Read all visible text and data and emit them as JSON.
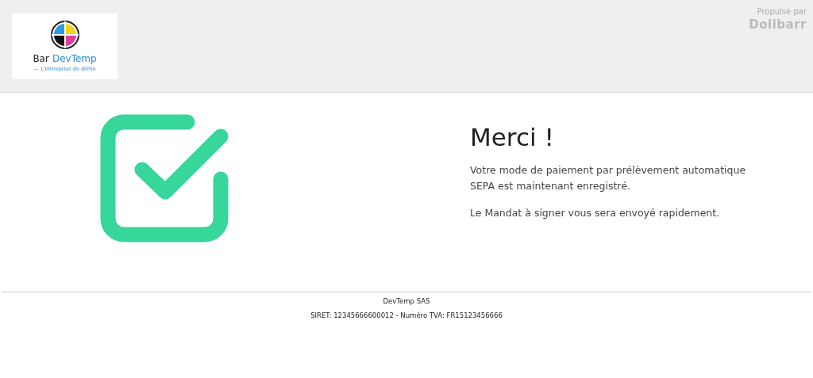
{
  "header": {
    "logo": {
      "name_part1": "Bar",
      "name_part2": "DevTemp",
      "tagline": "— L'entreprise de démo"
    },
    "powered_by": {
      "label": "Propulsé par",
      "brand": "Dolibarr"
    }
  },
  "message": {
    "title": "Merci !",
    "paragraphs": [
      "Votre mode de paiement par prélèvement automatique SEPA est maintenant enregistré.",
      "Le Mandat à signer vous sera envoyé rapidement."
    ]
  },
  "footer": {
    "company": "DevTemp SAS",
    "legal": "SIRET: 12345666600012 - Numéro TVA: FR15123456666"
  }
}
